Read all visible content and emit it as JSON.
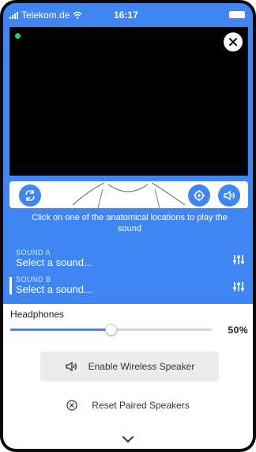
{
  "status_bar": {
    "carrier": "Telekom.de",
    "time": "16:17"
  },
  "instruction": "Click on one of the anatomical locations to play the sound",
  "sounds": [
    {
      "label": "SOUND A",
      "value": "Select a sound..."
    },
    {
      "label": "SOUND B",
      "value": "Select a sound..."
    }
  ],
  "output": {
    "label": "Headphones",
    "volume": 0.5,
    "volume_text": "50%"
  },
  "actions": {
    "enable_wireless": "Enable Wireless Speaker",
    "reset_paired": "Reset Paired Speakers"
  },
  "colors": {
    "accent": "#3f86f2",
    "live_dot": "#1fd66b"
  },
  "icons": [
    "wifi-icon",
    "close-icon",
    "refresh-icon",
    "gear-icon",
    "speaker-icon",
    "equalizer-icon",
    "x-circle-icon",
    "chevron-down-icon"
  ]
}
